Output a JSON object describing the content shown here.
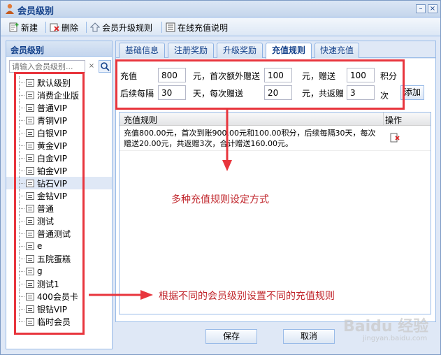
{
  "window": {
    "title": "会员级别",
    "min_label": "–",
    "close_label": "×"
  },
  "toolbar": {
    "new_label": "新建",
    "delete_label": "删除",
    "upgrade_rules_label": "会员升级规则",
    "online_recharge_label": "在线充值说明"
  },
  "left_panel": {
    "header": "会员级别",
    "search_placeholder": "请输入会员级别...",
    "items": [
      {
        "label": "默认级别"
      },
      {
        "label": "消费企业版"
      },
      {
        "label": "普通VIP"
      },
      {
        "label": "青铜VIP"
      },
      {
        "label": "白银VIP"
      },
      {
        "label": "黄金VIP"
      },
      {
        "label": "白金VIP"
      },
      {
        "label": "铂金VIP"
      },
      {
        "label": "钻石VIP",
        "selected": true
      },
      {
        "label": "金钻VIP"
      },
      {
        "label": "普通"
      },
      {
        "label": "测试"
      },
      {
        "label": "普通测试"
      },
      {
        "label": "e"
      },
      {
        "label": "五院蛋糕"
      },
      {
        "label": "g"
      },
      {
        "label": "测试1"
      },
      {
        "label": "400会员卡"
      },
      {
        "label": "银钻VIP"
      },
      {
        "label": "临时会员"
      }
    ]
  },
  "tabs": [
    {
      "label": "基础信息"
    },
    {
      "label": "注册奖励"
    },
    {
      "label": "升级奖励"
    },
    {
      "label": "充值规则",
      "active": true
    },
    {
      "label": "快速充值"
    }
  ],
  "form": {
    "recharge_label": "充值",
    "recharge_value": "800",
    "first_bonus_label": "元，首次额外赠送",
    "first_bonus_value": "100",
    "gift_label": "元，赠送",
    "gift_value": "100",
    "points_label": "积分",
    "interval_label": "后续每隔",
    "interval_value": "30",
    "each_gift_label": "天，每次赠送",
    "each_gift_value": "20",
    "total_label": "元，共返赠",
    "total_value": "3",
    "times_label": "次",
    "add_button": "添加"
  },
  "grid": {
    "col_rule": "充值规则",
    "col_action": "操作",
    "rows": [
      {
        "rule": "充值800.00元，首次到账900.00元和100.00积分，后续每隔30天，每次赠送20.00元，共返赠3次，合计赠送160.00元。"
      }
    ]
  },
  "annotations": {
    "rule_note": "多种充值规则设定方式",
    "level_note": "根据不同的会员级别设置不同的充值规则"
  },
  "buttons": {
    "save": "保存",
    "cancel": "取消"
  },
  "watermark": {
    "logo": "Baidu 经验",
    "url": "jingyan.baidu.com"
  },
  "colors": {
    "annotation_red": "#e8353d",
    "title_blue": "#15428b"
  }
}
